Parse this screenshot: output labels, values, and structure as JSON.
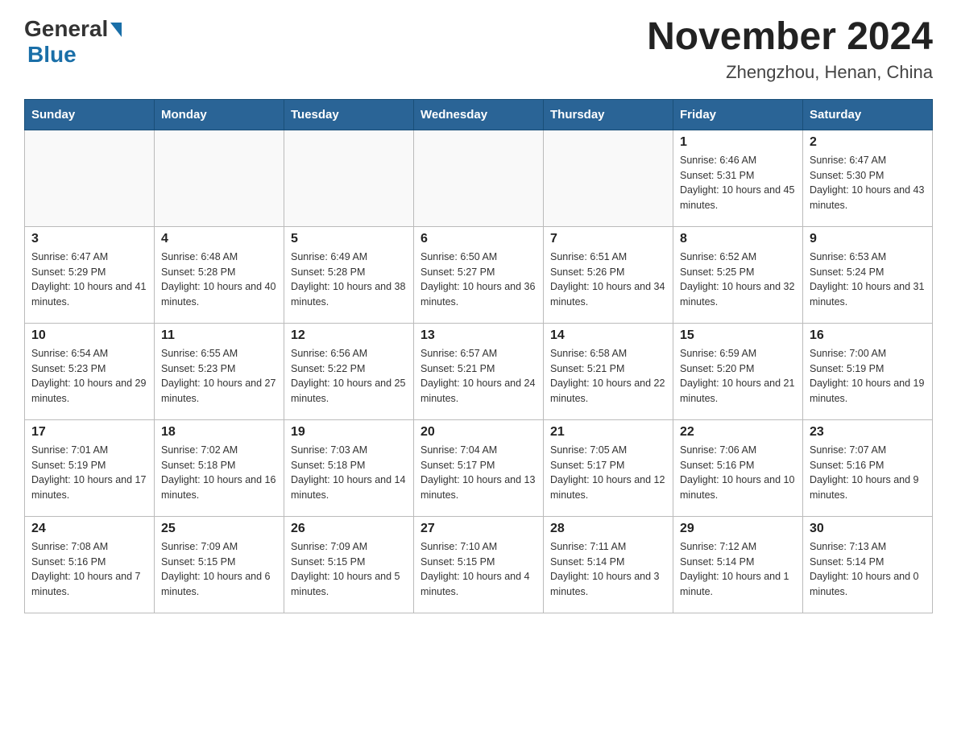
{
  "header": {
    "logo_general": "General",
    "logo_blue": "Blue",
    "month_title": "November 2024",
    "location": "Zhengzhou, Henan, China"
  },
  "days_of_week": [
    "Sunday",
    "Monday",
    "Tuesday",
    "Wednesday",
    "Thursday",
    "Friday",
    "Saturday"
  ],
  "weeks": [
    [
      {
        "day": "",
        "info": ""
      },
      {
        "day": "",
        "info": ""
      },
      {
        "day": "",
        "info": ""
      },
      {
        "day": "",
        "info": ""
      },
      {
        "day": "",
        "info": ""
      },
      {
        "day": "1",
        "info": "Sunrise: 6:46 AM\nSunset: 5:31 PM\nDaylight: 10 hours and 45 minutes."
      },
      {
        "day": "2",
        "info": "Sunrise: 6:47 AM\nSunset: 5:30 PM\nDaylight: 10 hours and 43 minutes."
      }
    ],
    [
      {
        "day": "3",
        "info": "Sunrise: 6:47 AM\nSunset: 5:29 PM\nDaylight: 10 hours and 41 minutes."
      },
      {
        "day": "4",
        "info": "Sunrise: 6:48 AM\nSunset: 5:28 PM\nDaylight: 10 hours and 40 minutes."
      },
      {
        "day": "5",
        "info": "Sunrise: 6:49 AM\nSunset: 5:28 PM\nDaylight: 10 hours and 38 minutes."
      },
      {
        "day": "6",
        "info": "Sunrise: 6:50 AM\nSunset: 5:27 PM\nDaylight: 10 hours and 36 minutes."
      },
      {
        "day": "7",
        "info": "Sunrise: 6:51 AM\nSunset: 5:26 PM\nDaylight: 10 hours and 34 minutes."
      },
      {
        "day": "8",
        "info": "Sunrise: 6:52 AM\nSunset: 5:25 PM\nDaylight: 10 hours and 32 minutes."
      },
      {
        "day": "9",
        "info": "Sunrise: 6:53 AM\nSunset: 5:24 PM\nDaylight: 10 hours and 31 minutes."
      }
    ],
    [
      {
        "day": "10",
        "info": "Sunrise: 6:54 AM\nSunset: 5:23 PM\nDaylight: 10 hours and 29 minutes."
      },
      {
        "day": "11",
        "info": "Sunrise: 6:55 AM\nSunset: 5:23 PM\nDaylight: 10 hours and 27 minutes."
      },
      {
        "day": "12",
        "info": "Sunrise: 6:56 AM\nSunset: 5:22 PM\nDaylight: 10 hours and 25 minutes."
      },
      {
        "day": "13",
        "info": "Sunrise: 6:57 AM\nSunset: 5:21 PM\nDaylight: 10 hours and 24 minutes."
      },
      {
        "day": "14",
        "info": "Sunrise: 6:58 AM\nSunset: 5:21 PM\nDaylight: 10 hours and 22 minutes."
      },
      {
        "day": "15",
        "info": "Sunrise: 6:59 AM\nSunset: 5:20 PM\nDaylight: 10 hours and 21 minutes."
      },
      {
        "day": "16",
        "info": "Sunrise: 7:00 AM\nSunset: 5:19 PM\nDaylight: 10 hours and 19 minutes."
      }
    ],
    [
      {
        "day": "17",
        "info": "Sunrise: 7:01 AM\nSunset: 5:19 PM\nDaylight: 10 hours and 17 minutes."
      },
      {
        "day": "18",
        "info": "Sunrise: 7:02 AM\nSunset: 5:18 PM\nDaylight: 10 hours and 16 minutes."
      },
      {
        "day": "19",
        "info": "Sunrise: 7:03 AM\nSunset: 5:18 PM\nDaylight: 10 hours and 14 minutes."
      },
      {
        "day": "20",
        "info": "Sunrise: 7:04 AM\nSunset: 5:17 PM\nDaylight: 10 hours and 13 minutes."
      },
      {
        "day": "21",
        "info": "Sunrise: 7:05 AM\nSunset: 5:17 PM\nDaylight: 10 hours and 12 minutes."
      },
      {
        "day": "22",
        "info": "Sunrise: 7:06 AM\nSunset: 5:16 PM\nDaylight: 10 hours and 10 minutes."
      },
      {
        "day": "23",
        "info": "Sunrise: 7:07 AM\nSunset: 5:16 PM\nDaylight: 10 hours and 9 minutes."
      }
    ],
    [
      {
        "day": "24",
        "info": "Sunrise: 7:08 AM\nSunset: 5:16 PM\nDaylight: 10 hours and 7 minutes."
      },
      {
        "day": "25",
        "info": "Sunrise: 7:09 AM\nSunset: 5:15 PM\nDaylight: 10 hours and 6 minutes."
      },
      {
        "day": "26",
        "info": "Sunrise: 7:09 AM\nSunset: 5:15 PM\nDaylight: 10 hours and 5 minutes."
      },
      {
        "day": "27",
        "info": "Sunrise: 7:10 AM\nSunset: 5:15 PM\nDaylight: 10 hours and 4 minutes."
      },
      {
        "day": "28",
        "info": "Sunrise: 7:11 AM\nSunset: 5:14 PM\nDaylight: 10 hours and 3 minutes."
      },
      {
        "day": "29",
        "info": "Sunrise: 7:12 AM\nSunset: 5:14 PM\nDaylight: 10 hours and 1 minute."
      },
      {
        "day": "30",
        "info": "Sunrise: 7:13 AM\nSunset: 5:14 PM\nDaylight: 10 hours and 0 minutes."
      }
    ]
  ]
}
